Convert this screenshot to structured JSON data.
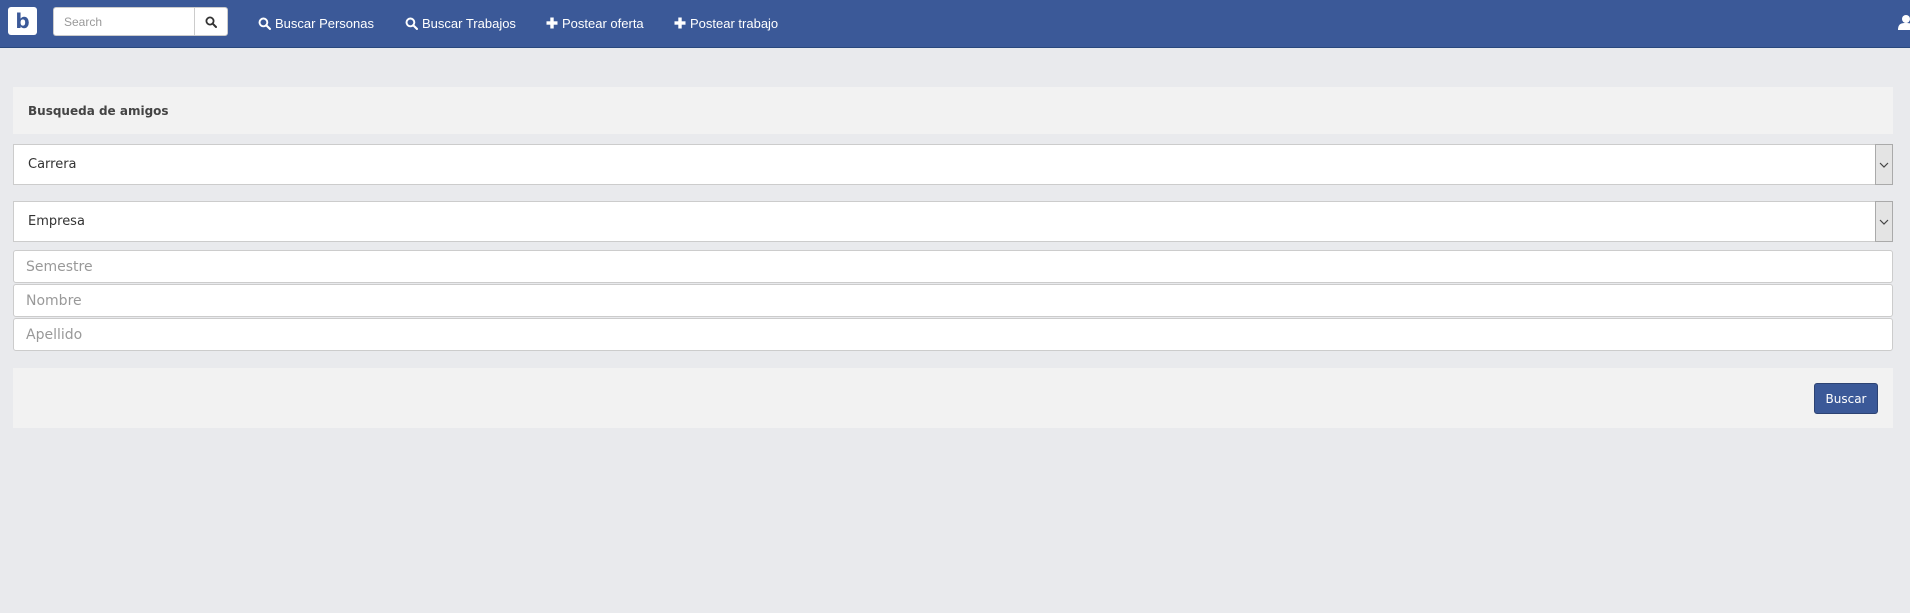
{
  "navbar": {
    "brand": "b",
    "search": {
      "placeholder": "Search",
      "value": ""
    },
    "items": [
      {
        "label": "Buscar Personas",
        "icon": "search-icon"
      },
      {
        "label": "Buscar Trabajos",
        "icon": "search-icon"
      },
      {
        "label": "Postear oferta",
        "icon": "plus-icon"
      },
      {
        "label": "Postear trabajo",
        "icon": "plus-icon"
      }
    ],
    "user_icon": "user-icon"
  },
  "panel": {
    "title": "Busqueda de amigos",
    "career_select": {
      "selected": "Carrera"
    },
    "company_select": {
      "selected": "Empresa"
    },
    "semester": {
      "placeholder": "Semestre",
      "value": ""
    },
    "first_name": {
      "placeholder": "Nombre",
      "value": ""
    },
    "last_name": {
      "placeholder": "Apellido",
      "value": ""
    },
    "submit_label": "Buscar"
  },
  "colors": {
    "navbar": "#3b5998",
    "background": "#e9eaed",
    "panel": "#f2f2f2",
    "button": "#3b5998"
  }
}
